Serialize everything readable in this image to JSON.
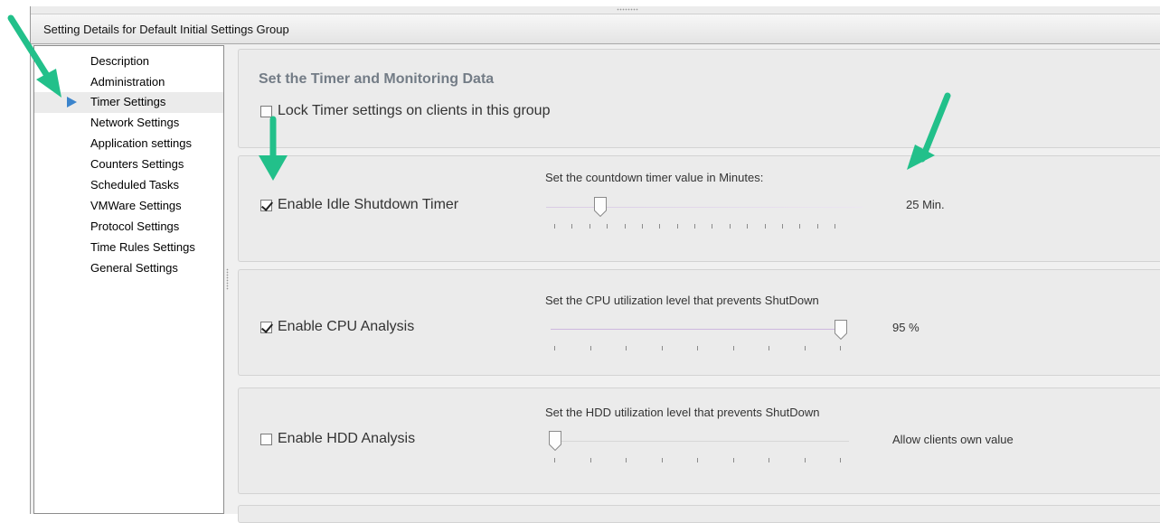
{
  "header": {
    "title": "Setting Details for Default Initial Settings Group"
  },
  "nav": {
    "items": [
      {
        "label": "Description",
        "active": false
      },
      {
        "label": "Administration",
        "active": false
      },
      {
        "label": "Timer Settings",
        "active": true
      },
      {
        "label": "Network Settings",
        "active": false
      },
      {
        "label": "Application settings",
        "active": false
      },
      {
        "label": "Counters Settings",
        "active": false
      },
      {
        "label": "Scheduled Tasks",
        "active": false
      },
      {
        "label": "VMWare Settings",
        "active": false
      },
      {
        "label": "Protocol Settings",
        "active": false
      },
      {
        "label": "Time Rules Settings",
        "active": false
      },
      {
        "label": "General Settings",
        "active": false
      }
    ]
  },
  "section": {
    "title": "Set the Timer and Monitoring Data",
    "lock": {
      "label": "Lock Timer  settings on clients in this group",
      "checked": false
    }
  },
  "idle": {
    "label": "Enable Idle Shutdown Timer",
    "checked": true,
    "caption": "Set the countdown timer value in Minutes:",
    "value_text": "25 Min.",
    "slider_fraction": 0.16
  },
  "cpu": {
    "label": "Enable CPU Analysis",
    "checked": true,
    "caption": "Set the CPU utilization level that prevents ShutDown",
    "value_text": "95 %",
    "slider_fraction": 1.0
  },
  "hdd": {
    "label": "Enable HDD Analysis",
    "checked": false,
    "caption": "Set the HDD utilization level that prevents ShutDown",
    "value_text": "Allow clients own value",
    "slider_fraction": 0.0
  },
  "colors": {
    "accent_arrow": "#22c08a",
    "nav_active_arrow": "#3b84cc",
    "section_title": "#737c86"
  },
  "icons": {
    "nav_active": "triangle-right-icon",
    "slider_thumb": "slider-thumb-icon",
    "callout": "green-arrow-icon"
  }
}
